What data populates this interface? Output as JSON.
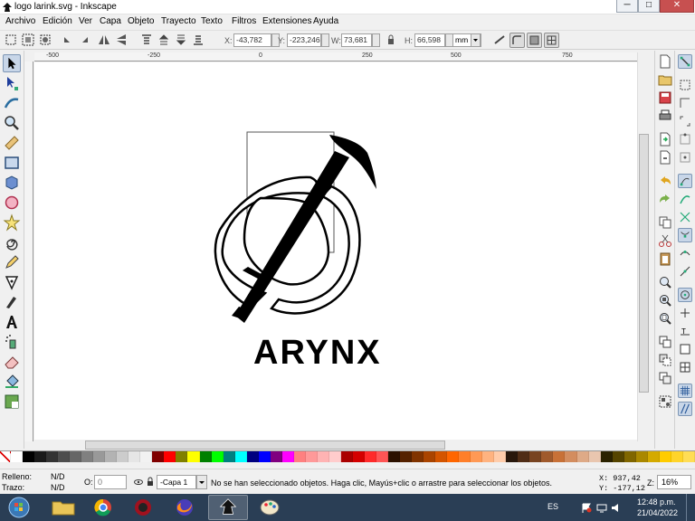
{
  "window": {
    "title": "logo larink.svg - Inkscape",
    "min_glyph": "─",
    "max_glyph": "□",
    "close_glyph": "✕"
  },
  "menu": [
    "Archivo",
    "Edición",
    "Ver",
    "Capa",
    "Objeto",
    "Trayecto",
    "Texto",
    "Filtros",
    "Extensiones",
    "Ayuda"
  ],
  "toolbar": {
    "x_label": "X:",
    "x_value": "-43,782",
    "y_label": "Y:",
    "y_value": "-223,246",
    "w_label": "W:",
    "w_value": "73,681",
    "h_label": "H:",
    "h_value": "66,598",
    "unit": "mm"
  },
  "rulers": {
    "top_ticks": [
      "-500",
      "-250",
      "0",
      "250",
      "500",
      "750"
    ]
  },
  "canvas": {
    "logo_text": "ARYNX"
  },
  "palette_colors": [
    "#ffffff",
    "#000000",
    "#1a1a1a",
    "#333333",
    "#4d4d4d",
    "#666666",
    "#808080",
    "#999999",
    "#b3b3b3",
    "#cccccc",
    "#e6e6e6",
    "#f2f2f2",
    "#800000",
    "#ff0000",
    "#808000",
    "#ffff00",
    "#008000",
    "#00ff00",
    "#008080",
    "#00ffff",
    "#000080",
    "#0000ff",
    "#800080",
    "#ff00ff",
    "#ff8080",
    "#ff9999",
    "#ffb3b3",
    "#ffcccc",
    "#aa0000",
    "#d40000",
    "#ff2a2a",
    "#ff5555",
    "#2b1100",
    "#552200",
    "#803300",
    "#aa4400",
    "#d45500",
    "#ff6600",
    "#ff7f2a",
    "#ff9955",
    "#ffb380",
    "#ffccaa",
    "#28170b",
    "#502d16",
    "#784421",
    "#a05a2c",
    "#c87137",
    "#d38d5f",
    "#deaa87",
    "#e9c6af",
    "#2b2200",
    "#554400",
    "#806600",
    "#aa8800",
    "#d4aa00",
    "#ffcc00",
    "#ffd42a",
    "#ffdd55"
  ],
  "status": {
    "fill_label": "Relleno:",
    "fill_value": "N/D",
    "stroke_label": "Trazo:",
    "stroke_value": "N/D",
    "opacity_label": "O:",
    "opacity_value": "0",
    "layer": "-Capa 1",
    "message": "No se han seleccionado objetos. Haga clic, Mayús+clic o arrastre para seleccionar los objetos.",
    "x_coord": "X:  937,42",
    "y_coord": "Y: -177,12",
    "zoom_label": "Z:",
    "zoom_value": "16%"
  },
  "taskbar": {
    "lang": "ES",
    "time": "12:48 p.m.",
    "date": "21/04/2022"
  }
}
